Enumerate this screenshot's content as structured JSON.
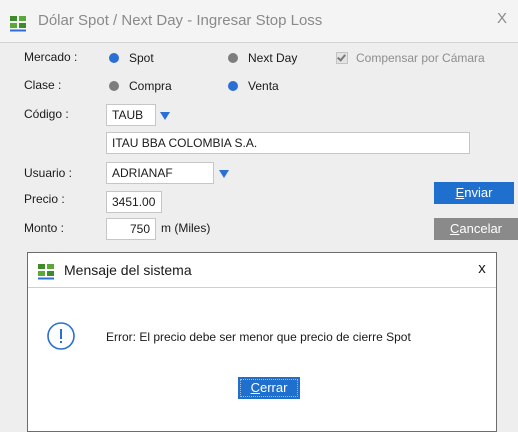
{
  "window": {
    "title": "Dólar Spot / Next Day - Ingresar Stop Loss",
    "close_glyph": "X",
    "logo_icon": "ses-logo-icon"
  },
  "form": {
    "mercado": {
      "label": "Mercado :",
      "options": [
        {
          "label": "Spot",
          "selected": true
        },
        {
          "label": "Next Day",
          "selected": false
        }
      ],
      "compensar": {
        "label": "Compensar por Cámara",
        "checked": true,
        "disabled": true
      }
    },
    "clase": {
      "label": "Clase :",
      "options": [
        {
          "label": "Compra",
          "selected": false
        },
        {
          "label": "Venta",
          "selected": true
        }
      ]
    },
    "codigo": {
      "label": "Código :",
      "value": "TAUB",
      "description": "ITAU BBA COLOMBIA S.A."
    },
    "usuario": {
      "label": "Usuario :",
      "value": "ADRIANAF"
    },
    "precio": {
      "label": "Precio :",
      "value": "3451.00"
    },
    "monto": {
      "label": "Monto :",
      "value": "750",
      "unit": "m (Miles)"
    }
  },
  "buttons": {
    "enviar": {
      "first": "E",
      "rest": "nviar"
    },
    "cancelar": {
      "first": "C",
      "rest": "ancelar"
    }
  },
  "dialog": {
    "title": "Mensaje del sistema",
    "close_glyph": "x",
    "message": "Error: El precio debe ser menor que precio de cierre Spot",
    "icon": "info-icon",
    "button": {
      "first": "C",
      "rest": "errar"
    }
  },
  "colors": {
    "accent": "#1f6fcf",
    "radio_on": "#2b6fd4",
    "radio_off": "#7d7d7d",
    "cancel": "#8a8a8a",
    "logo_green": "#3f8a2a"
  }
}
